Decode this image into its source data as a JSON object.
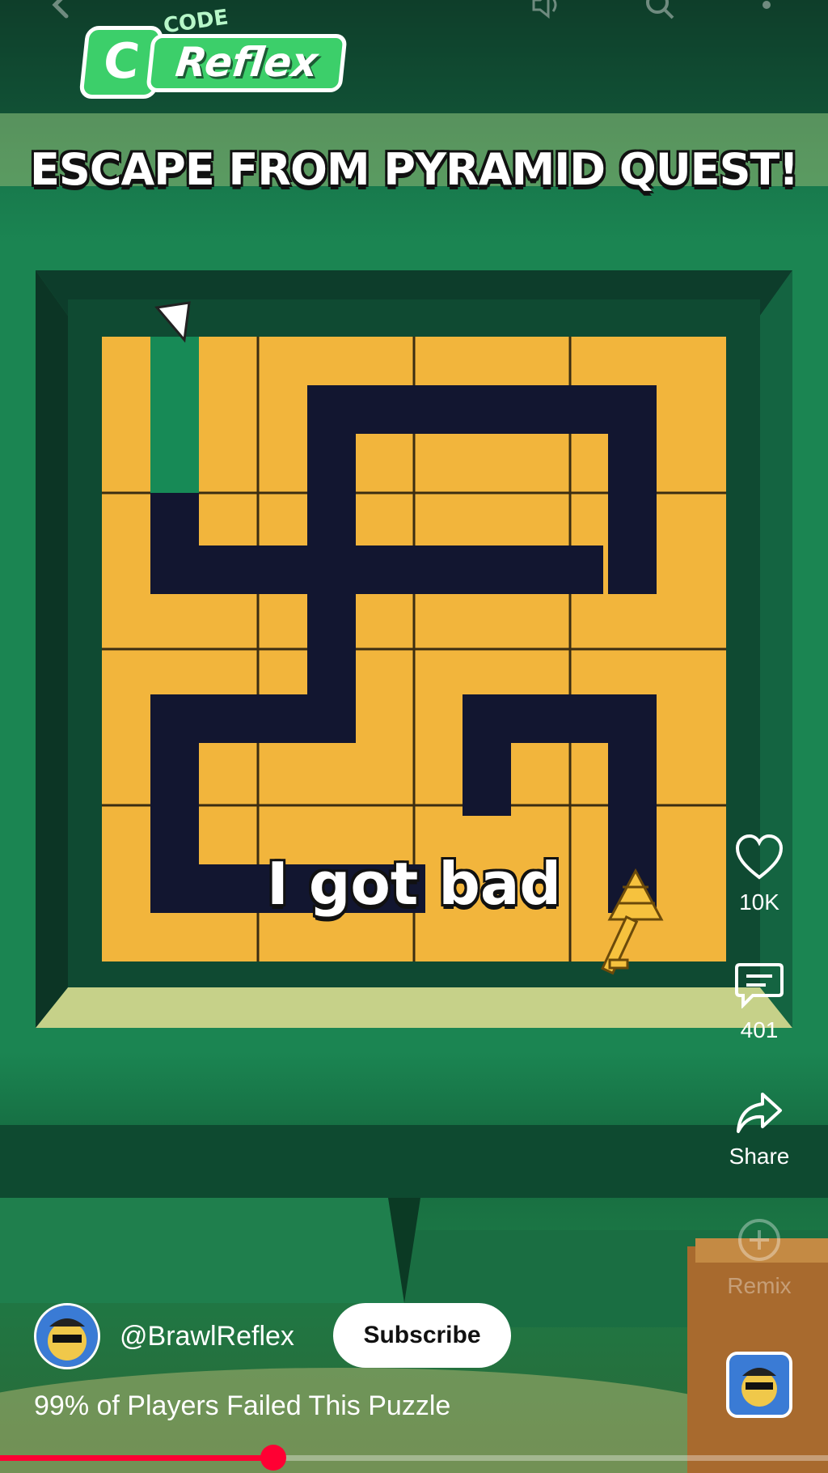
{
  "channel": {
    "logo_small": "CODE",
    "logo_letter": "C",
    "logo_word": "Reflex"
  },
  "video": {
    "title": "ESCAPE FROM PYRAMID QUEST!",
    "caption": "I got bad",
    "description": "99% of Players Failed This Puzzle",
    "progress": 0.33
  },
  "rail": {
    "likes": "10K",
    "comments": "401",
    "share": "Share",
    "remix": "Remix"
  },
  "author": {
    "handle": "@BrawlReflex",
    "subscribe": "Subscribe"
  },
  "colors": {
    "maze_wall": "#f2b53c",
    "maze_path": "#121630",
    "background": "#1b8552",
    "accent": "#ff0033"
  },
  "icons": [
    "back-icon",
    "volume-icon",
    "search-icon",
    "more-icon",
    "heart-icon",
    "comment-icon",
    "share-icon",
    "remix-icon"
  ]
}
